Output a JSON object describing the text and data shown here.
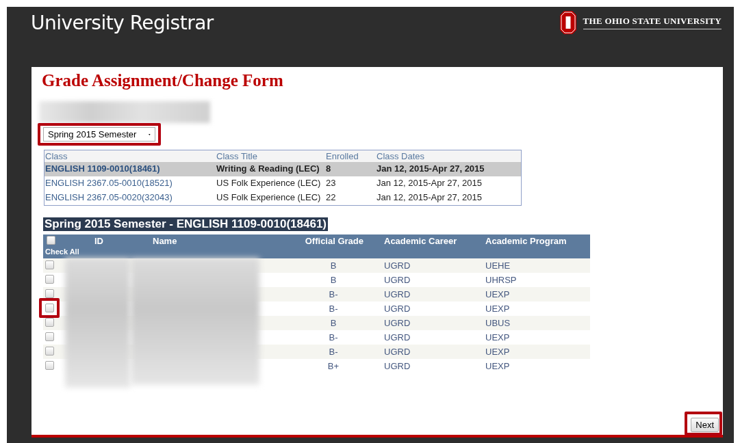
{
  "header": {
    "title": "University Registrar",
    "logo_text": "THE OHIO STATE UNIVERSITY"
  },
  "form": {
    "title": "Grade Assignment/Change Form",
    "term_select": {
      "value": "Spring 2015 Semester",
      "highlighted": true
    },
    "classes": {
      "columns": [
        "Class",
        "Class Title",
        "Enrolled",
        "Class Dates"
      ],
      "rows": [
        {
          "class": "ENGLISH 1109-0010(18461)",
          "title": "Writing & Reading (LEC)",
          "enrolled": "8",
          "dates": "Jan 12, 2015-Apr 27, 2015",
          "selected": true
        },
        {
          "class": "ENGLISH 2367.05-0010(18521)",
          "title": "US Folk Experience (LEC)",
          "enrolled": "23",
          "dates": "Jan 12, 2015-Apr 27, 2015",
          "selected": false
        },
        {
          "class": "ENGLISH 2367.05-0020(32043)",
          "title": "US Folk Experience (LEC)",
          "enrolled": "22",
          "dates": "Jan 12, 2015-Apr 27, 2015",
          "selected": false
        }
      ]
    },
    "roster": {
      "heading": "Spring 2015 Semester - ENGLISH 1109-0010(18461)",
      "check_all": {
        "label": "Check All",
        "checked": false
      },
      "columns": [
        "ID",
        "Name",
        "Official Grade",
        "Academic Career",
        "Academic Program"
      ],
      "rows": [
        {
          "checked": false,
          "highlighted": false,
          "grade": "B",
          "career": "UGRD",
          "program": "UEHE"
        },
        {
          "checked": false,
          "highlighted": false,
          "grade": "B",
          "career": "UGRD",
          "program": "UHRSP"
        },
        {
          "checked": false,
          "highlighted": false,
          "grade": "B-",
          "career": "UGRD",
          "program": "UEXP"
        },
        {
          "checked": false,
          "highlighted": true,
          "grade": "B-",
          "career": "UGRD",
          "program": "UEXP"
        },
        {
          "checked": false,
          "highlighted": false,
          "grade": "B",
          "career": "UGRD",
          "program": "UBUS"
        },
        {
          "checked": false,
          "highlighted": false,
          "grade": "B-",
          "career": "UGRD",
          "program": "UEXP"
        },
        {
          "checked": false,
          "highlighted": false,
          "grade": "B-",
          "career": "UGRD",
          "program": "UEXP"
        },
        {
          "checked": false,
          "highlighted": false,
          "grade": "B+",
          "career": "UGRD",
          "program": "UEXP"
        }
      ]
    },
    "next_button": {
      "label": "Next",
      "highlighted": true
    }
  }
}
